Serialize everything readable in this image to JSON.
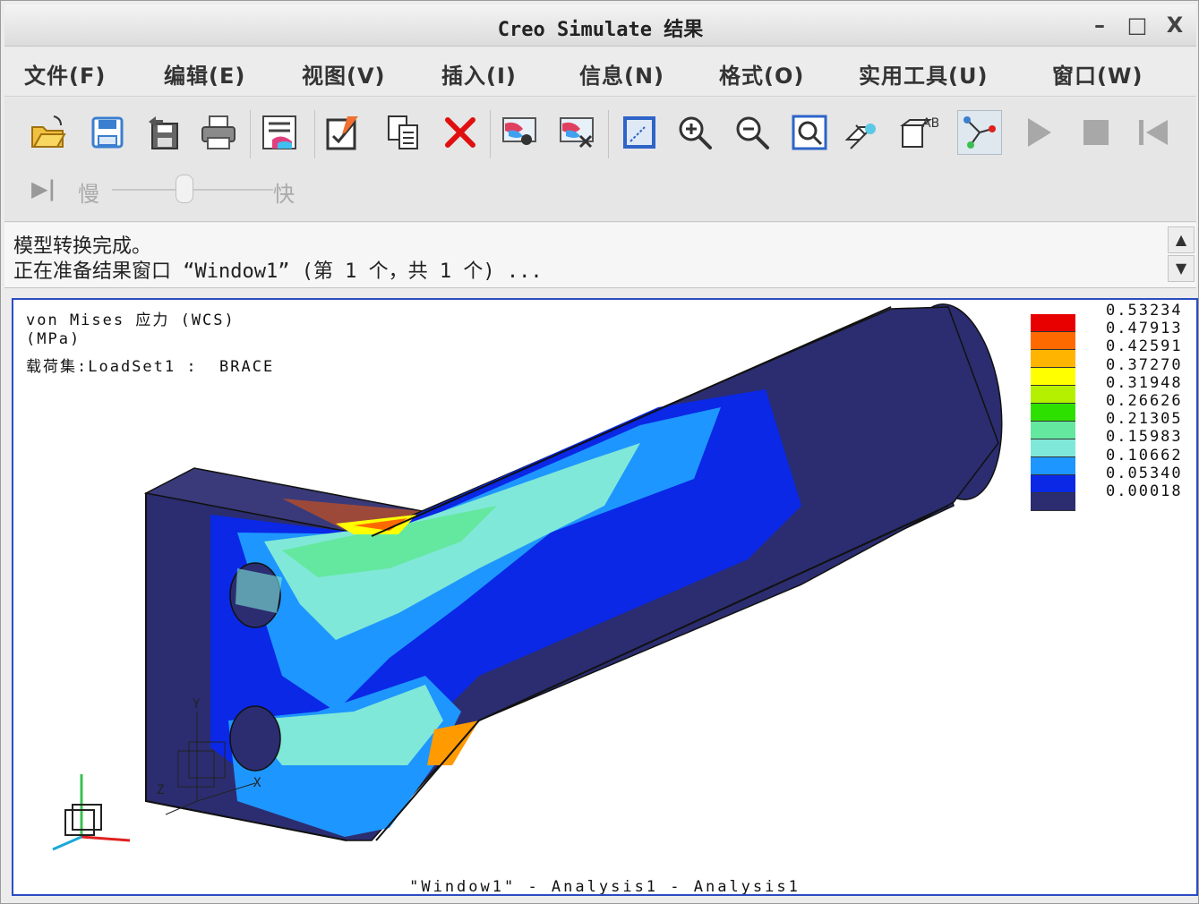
{
  "window": {
    "title": "Creo Simulate 结果",
    "minimize": "–",
    "maximize": "□",
    "close": "X"
  },
  "menu": {
    "items": [
      "文件(F)",
      "编辑(E)",
      "视图(V)",
      "插入(I)",
      "信息(N)",
      "格式(O)",
      "实用工具(U)",
      "窗口(W)"
    ]
  },
  "toolbar": {
    "buttons": [
      "open-icon",
      "save-icon",
      "save-as-icon",
      "print-icon",
      "legend-list-icon",
      "edit-icon",
      "copy-icon",
      "delete-icon",
      "show-result-icon",
      "hide-result-icon",
      "view-icon",
      "zoom-in-icon",
      "zoom-out-icon",
      "refit-icon",
      "orient-icon",
      "annotation-icon",
      "query-icon",
      "play-icon",
      "stop-icon",
      "rewind-icon"
    ],
    "speed": {
      "step_label": "▶|",
      "slow": "慢",
      "fast": "快",
      "level": 0.45
    }
  },
  "messages": {
    "line1": "模型转换完成。",
    "line2": "正在准备结果窗口 “Window1” (第 1 个，共 1 个) ..."
  },
  "viewport": {
    "header_line1": "von Mises 应力 (WCS)",
    "header_line2": "(MPa)",
    "header_line3": "载荷集:LoadSet1 :  BRACE",
    "footer": "\"Window1\" - Analysis1 - Analysis1",
    "axis_labels": {
      "y": "Y",
      "z": "Z",
      "x": "X"
    }
  },
  "legend": {
    "values": [
      "0.53234",
      "0.47913",
      "0.42591",
      "0.37270",
      "0.31948",
      "0.26626",
      "0.21305",
      "0.15983",
      "0.10662",
      "0.05340",
      "0.00018"
    ],
    "colors": [
      "#e80000",
      "#ff6a00",
      "#ffb400",
      "#ffff00",
      "#b4f000",
      "#2ee000",
      "#64e8a0",
      "#80e8d8",
      "#1e96ff",
      "#0a28e6",
      "#2b2d70"
    ]
  }
}
